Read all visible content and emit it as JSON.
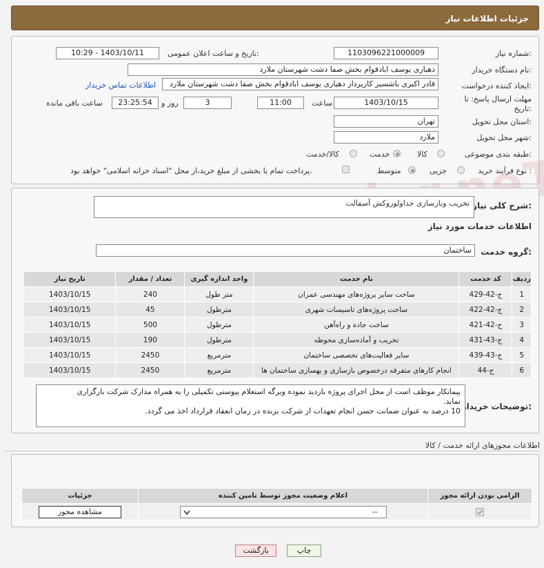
{
  "header": {
    "title": "جزئیات اطلاعات نیاز"
  },
  "form": {
    "need_number_label": "شماره نیاز:",
    "need_number": "1103096221000009",
    "announce_label": "تاریخ و ساعت اعلان عمومی:",
    "announce_value": "1403/10/11 - 10:29",
    "buyer_label": "نام دستگاه خریدار:",
    "buyer_value": "دهیاری یوسف ابادقوام بخش صفا دشت شهرستان ملارد",
    "requester_label": "ایجاد کننده درخواست:",
    "requester_value": "قادر اکبری باشسیز کارپرداز دهیاری یوسف ابادقوام بخش صفا دشت شهرستان ملارد",
    "contact_link": "اطلاعات تماس خریدار",
    "deadline_label_1": "مهلت ارسال پاسخ: تا",
    "deadline_label_2": "تاریخ:",
    "deadline_date": "1403/10/15",
    "time_label": "ساعت",
    "deadline_time": "11:00",
    "days_value": "3",
    "days_label": "روز و",
    "remaining_time": "23:25:54",
    "remaining_label": "ساعت باقی مانده",
    "province_label": "استان محل تحویل:",
    "province_value": "تهران",
    "city_label": "شهر محل تحویل:",
    "city_value": "ملارد",
    "category_label": "طبقه بندی موضوعی:",
    "category_options": [
      "کالا",
      "خدمت",
      "کالا/خدمت"
    ],
    "category_selected": "خدمت",
    "process_label": "نوع فرآیند خرید :",
    "process_options": [
      "جزیی",
      "متوسط"
    ],
    "process_selected": "متوسط",
    "payment_note": "پرداخت تمام یا بخشی از مبلغ خرید،از محل \"اسناد خزانه اسلامی\" خواهد بود."
  },
  "need": {
    "desc_label": "شرح کلی نیاز:",
    "desc_value": "تخریب وبازسازی جداولوروکش آسفالت",
    "services_title": "اطلاعات خدمات مورد نیاز",
    "group_label": "گروه خدمت:",
    "group_value": "ساختمان"
  },
  "services_table": {
    "headers": [
      "ردیف",
      "کد خدمت",
      "نام خدمت",
      "واحد اندازه گیری",
      "تعداد / مقدار",
      "تاریخ نیاز"
    ],
    "rows": [
      [
        "1",
        "ج-42-429",
        "ساخت سایر پروژه‌های مهندسی عمران",
        "متر طول",
        "240",
        "1403/10/15"
      ],
      [
        "2",
        "ج-42-422",
        "ساخت پروژه‌های تاسیسات شهری",
        "مترطول",
        "45",
        "1403/10/15"
      ],
      [
        "3",
        "ج-42-421",
        "ساخت جاده و راه‌آهن",
        "مترطول",
        "500",
        "1403/10/15"
      ],
      [
        "4",
        "ج-43-431",
        "تخریب و آماده‌سازی محوطه",
        "مترطول",
        "190",
        "1403/10/15"
      ],
      [
        "5",
        "ج-43-439",
        "سایر فعالیت‌های تخصصی ساختمان",
        "مترمربع",
        "2450",
        "1403/10/15"
      ],
      [
        "6",
        "ج-44",
        "انجام کارهای متفرقه درخصوص بازسازی و بهسازی ساختمان ها",
        "مترمربع",
        "2450",
        "1403/10/15"
      ]
    ]
  },
  "buyer_notes": {
    "label": "توضیحات خریدار:",
    "line1": "پیمانکار موظف است از محل اجرای پروژه بازدید نموده وبرگه استعلام پیوستی تکمیلی را به همراه مدارک شرکت بارگزاری",
    "line2": "نماید.",
    "line3": "10 درصد به عنوان ضمانت حسن انجام تعهدات از شرکت برنده در زمان انعقاد قرارداد اخذ می گردد."
  },
  "licenses": {
    "title": "اطلاعات مجوزهای ارائه خدمت / کالا",
    "headers": [
      "الزامی بودن ارائه مجوز",
      "اعلام وضعیت مجوز توسط تامین کننده",
      "جزئیات"
    ],
    "select_value": "--",
    "view_button": "مشاهده مجوز"
  },
  "buttons": {
    "print": "چاپ",
    "back": "بازگشت"
  },
  "watermark": "AriaTender.neT"
}
